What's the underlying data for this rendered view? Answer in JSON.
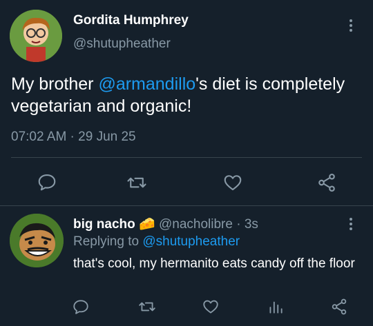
{
  "main_tweet": {
    "author_name": "Gordita Humphrey",
    "author_handle": "@shutupheather",
    "text_before_mention": "My brother ",
    "mention": "@armandillo",
    "text_after_mention": "'s diet is completely vegetarian and organic!",
    "timestamp": "07:02 AM · 29 Jun 25"
  },
  "reply_tweet": {
    "author_name": "big nacho",
    "author_emoji": "🧀",
    "author_handle": "@nacholibre",
    "time_ago": "· 3s",
    "replying_prefix": "Replying to ",
    "replying_handle": "@shutupheather",
    "text": "that's cool, my hermanito eats candy off the floor"
  },
  "icons": {
    "reply": "speech-bubble-icon",
    "retweet": "retweet-icon",
    "like": "heart-icon",
    "share": "share-icon",
    "views": "bar-chart-icon",
    "more": "kebab-menu-icon"
  },
  "colors": {
    "background": "#15202b",
    "accent": "#1d9bf0",
    "muted": "#8899a6",
    "divider": "#38444d"
  }
}
